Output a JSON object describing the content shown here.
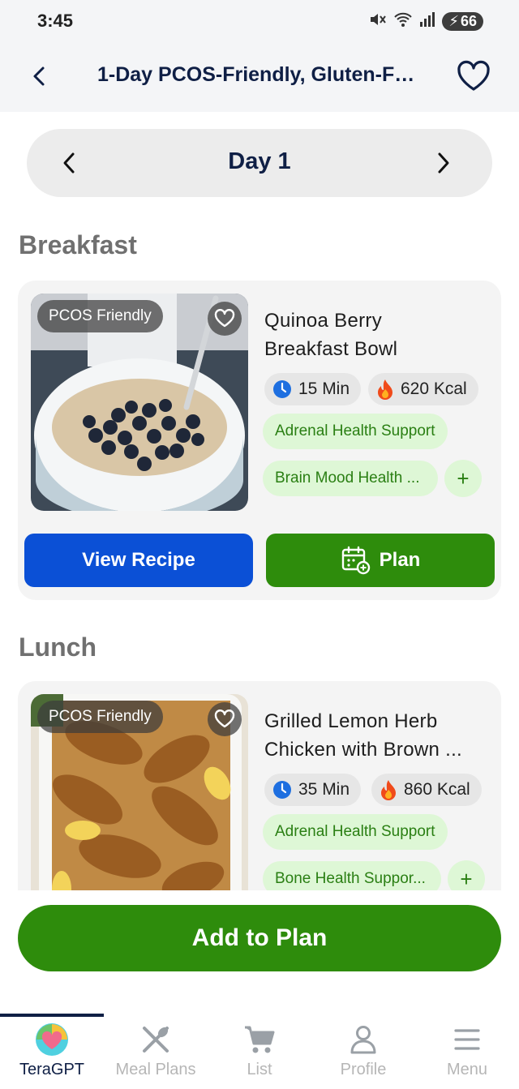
{
  "status_bar": {
    "time": "3:45",
    "battery": "66"
  },
  "header": {
    "title": "1-Day PCOS-Friendly, Gluten-Free ..."
  },
  "day_selector": {
    "label": "Day 1"
  },
  "meals": [
    {
      "section": "Breakfast",
      "badge": "PCOS Friendly",
      "title_line1": "Quinoa Berry",
      "title_line2": "Breakfast Bowl",
      "time": "15 Min",
      "kcal": "620 Kcal",
      "tag1": "Adrenal Health Support",
      "tag2": "Brain Mood Health ...",
      "plus": "+",
      "view_label": "View Recipe",
      "plan_label": "Plan"
    },
    {
      "section": "Lunch",
      "badge": "PCOS Friendly",
      "title_line1": "Grilled Lemon Herb",
      "title_line2": "Chicken with Brown ...",
      "time": "35 Min",
      "kcal": "860 Kcal",
      "tag1": "Adrenal Health Support",
      "tag2": "Bone Health Suppor...",
      "plus": "+"
    }
  ],
  "add_to_plan": "Add to Plan",
  "bottom_nav": [
    {
      "label": "TeraGPT",
      "icon": "teragpt-logo-icon",
      "active": true
    },
    {
      "label": "Meal Plans",
      "icon": "fork-knife-icon",
      "active": false
    },
    {
      "label": "List",
      "icon": "cart-icon",
      "active": false
    },
    {
      "label": "Profile",
      "icon": "person-icon",
      "active": false
    },
    {
      "label": "Menu",
      "icon": "hamburger-icon",
      "active": false
    }
  ],
  "colors": {
    "primary_green": "#2e8c0c",
    "primary_blue": "#0b50d6",
    "navy": "#0f1f45",
    "tag_bg": "#def7d6"
  }
}
